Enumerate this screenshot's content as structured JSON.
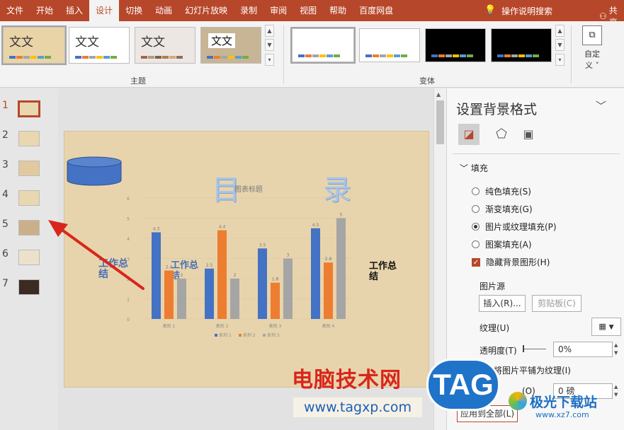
{
  "tabs": [
    "文件",
    "开始",
    "插入",
    "设计",
    "切换",
    "动画",
    "幻灯片放映",
    "录制",
    "审阅",
    "视图",
    "帮助",
    "百度网盘"
  ],
  "active_tab": "设计",
  "tell_me": "操作说明搜索",
  "share": "共享",
  "ribbon": {
    "themes_label": "主题",
    "variants_label": "变体",
    "customize_label_1": "自定",
    "customize_label_2": "义",
    "theme_text": "文文",
    "theme_text_4": "文文"
  },
  "slides": [
    "1",
    "2",
    "3",
    "4",
    "5",
    "6",
    "7"
  ],
  "slide": {
    "title_left": "目",
    "title_right": "录",
    "chart_title": "图表标题",
    "left_text": "工作总结",
    "mid_text": "工作总结",
    "right_text": "工作总结"
  },
  "chart_data": {
    "type": "bar",
    "title": "图表标题",
    "categories": [
      "类别 1",
      "类别 2",
      "类别 3",
      "类别 4"
    ],
    "series": [
      {
        "name": "系列 1",
        "values": [
          4.3,
          2.5,
          3.5,
          4.5
        ],
        "color": "#4472c4"
      },
      {
        "name": "系列 2",
        "values": [
          2.4,
          4.4,
          1.8,
          2.8
        ],
        "color": "#ed7d31"
      },
      {
        "name": "系列 3",
        "values": [
          2,
          2,
          3,
          5
        ],
        "color": "#a5a5a5"
      }
    ],
    "ylim": [
      0,
      6
    ],
    "yticks": [
      "0",
      "1",
      "2",
      "3",
      "4",
      "5",
      "6"
    ],
    "legend": "bottom"
  },
  "pane": {
    "title": "设置背景格式",
    "section": "填充",
    "options": [
      "纯色填充(S)",
      "渐变填充(G)",
      "图片或纹理填充(P)",
      "图案填充(A)"
    ],
    "selected": 2,
    "hide_bg": "隐藏背景图形(H)",
    "image_source": "图片源",
    "insert_btn": "插入(R)...",
    "clipboard_btn": "剪贴板(C)",
    "texture": "纹理(U)",
    "transparency": "透明度(T)",
    "transparency_value": "0%",
    "tile_label": "将图片平铺为纹理(I)",
    "offset_label": "(O)",
    "offset_value": "0 磅",
    "apply_all": "应用到全部(L)"
  },
  "watermark": {
    "site_name": "电脑技术网",
    "url": "www.tagxp.com",
    "tag": "TAG",
    "brand": "极光下载站",
    "brand_url": "www.xz7.com"
  },
  "colors": {
    "accent": "#b7472a",
    "red_arrow": "#d9261c"
  }
}
